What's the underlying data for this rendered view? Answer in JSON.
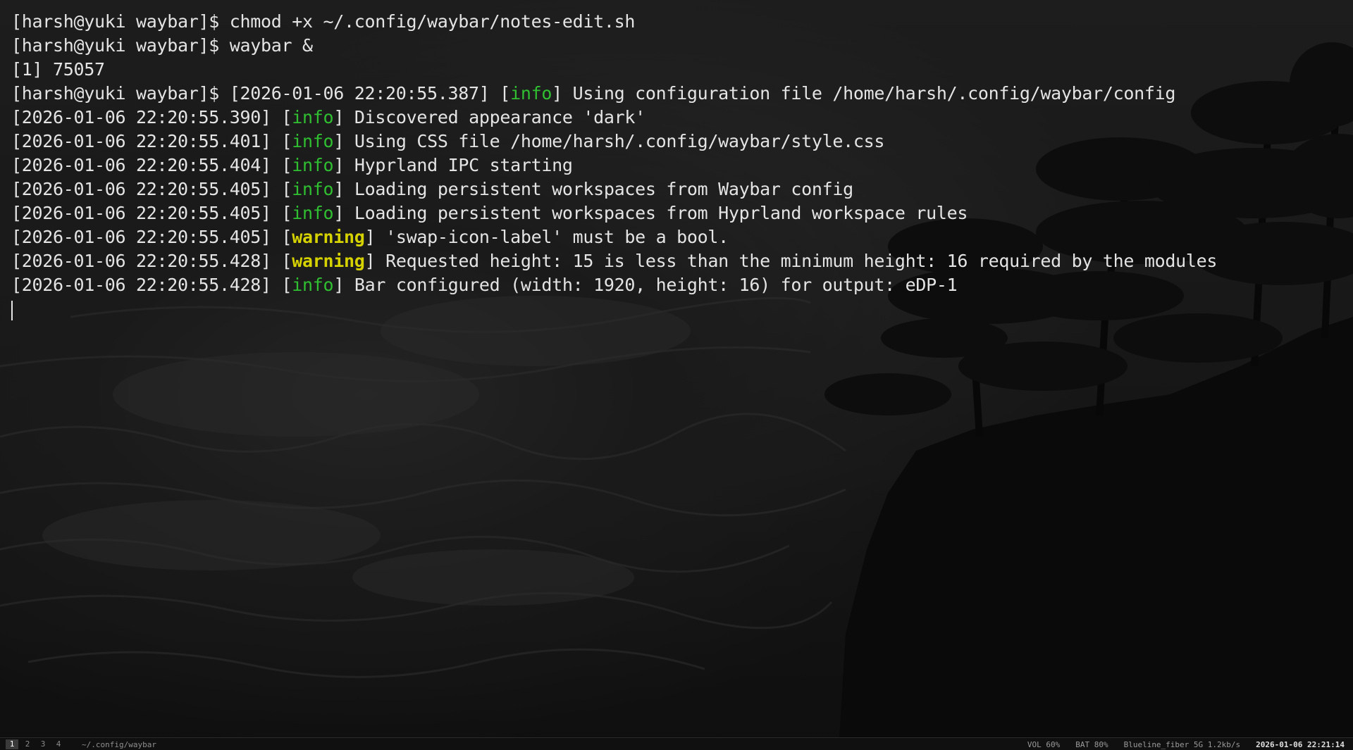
{
  "terminal": {
    "lines": [
      {
        "segments": [
          {
            "text": "[harsh@yuki waybar]$ chmod +x ~/.config/waybar/notes-edit.sh",
            "kind": "plain"
          }
        ]
      },
      {
        "segments": [
          {
            "text": "[harsh@yuki waybar]$ waybar &",
            "kind": "plain"
          }
        ]
      },
      {
        "segments": [
          {
            "text": "[1] 75057",
            "kind": "plain"
          }
        ]
      },
      {
        "segments": [
          {
            "text": "[harsh@yuki waybar]$ [2026-01-06 22:20:55.387] [",
            "kind": "plain"
          },
          {
            "text": "info",
            "kind": "info"
          },
          {
            "text": "] Using configuration file /home/harsh/.config/waybar/config",
            "kind": "plain"
          }
        ]
      },
      {
        "segments": [
          {
            "text": "[2026-01-06 22:20:55.390] [",
            "kind": "plain"
          },
          {
            "text": "info",
            "kind": "info"
          },
          {
            "text": "] Discovered appearance 'dark'",
            "kind": "plain"
          }
        ]
      },
      {
        "segments": [
          {
            "text": "[2026-01-06 22:20:55.401] [",
            "kind": "plain"
          },
          {
            "text": "info",
            "kind": "info"
          },
          {
            "text": "] Using CSS file /home/harsh/.config/waybar/style.css",
            "kind": "plain"
          }
        ]
      },
      {
        "segments": [
          {
            "text": "[2026-01-06 22:20:55.404] [",
            "kind": "plain"
          },
          {
            "text": "info",
            "kind": "info"
          },
          {
            "text": "] Hyprland IPC starting",
            "kind": "plain"
          }
        ]
      },
      {
        "segments": [
          {
            "text": "[2026-01-06 22:20:55.405] [",
            "kind": "plain"
          },
          {
            "text": "info",
            "kind": "info"
          },
          {
            "text": "] Loading persistent workspaces from Waybar config",
            "kind": "plain"
          }
        ]
      },
      {
        "segments": [
          {
            "text": "[2026-01-06 22:20:55.405] [",
            "kind": "plain"
          },
          {
            "text": "info",
            "kind": "info"
          },
          {
            "text": "] Loading persistent workspaces from Hyprland workspace rules",
            "kind": "plain"
          }
        ]
      },
      {
        "segments": [
          {
            "text": "[2026-01-06 22:20:55.405] [",
            "kind": "plain"
          },
          {
            "text": "warning",
            "kind": "warning"
          },
          {
            "text": "] 'swap-icon-label' must be a bool.",
            "kind": "plain"
          }
        ]
      },
      {
        "segments": [
          {
            "text": "[2026-01-06 22:20:55.428] [",
            "kind": "plain"
          },
          {
            "text": "warning",
            "kind": "warning"
          },
          {
            "text": "] Requested height: 15 is less than the minimum height: 16 required by the modules",
            "kind": "plain"
          }
        ]
      },
      {
        "segments": [
          {
            "text": "[2026-01-06 22:20:55.428] [",
            "kind": "plain"
          },
          {
            "text": "info",
            "kind": "info"
          },
          {
            "text": "] Bar configured (width: 1920, height: 16) for output: eDP-1",
            "kind": "plain"
          }
        ]
      }
    ]
  },
  "statusbar": {
    "workspaces": [
      {
        "label": "1",
        "active": true
      },
      {
        "label": "2",
        "active": false
      },
      {
        "label": "3",
        "active": false
      },
      {
        "label": "4",
        "active": false
      }
    ],
    "window_title": "~/.config/waybar",
    "volume": "VOL 60%",
    "battery": "BAT 80%",
    "network": "Blueline_fiber 5G 1.2kb/s",
    "clock": "2026-01-06 22:21:14"
  },
  "colors": {
    "info": "#2fbf31",
    "warning": "#d6d200",
    "text": "#e4e4e4",
    "active_workspace_bg": "#3a3a3a"
  },
  "icons": [
    "terminal-cursor-icon"
  ]
}
